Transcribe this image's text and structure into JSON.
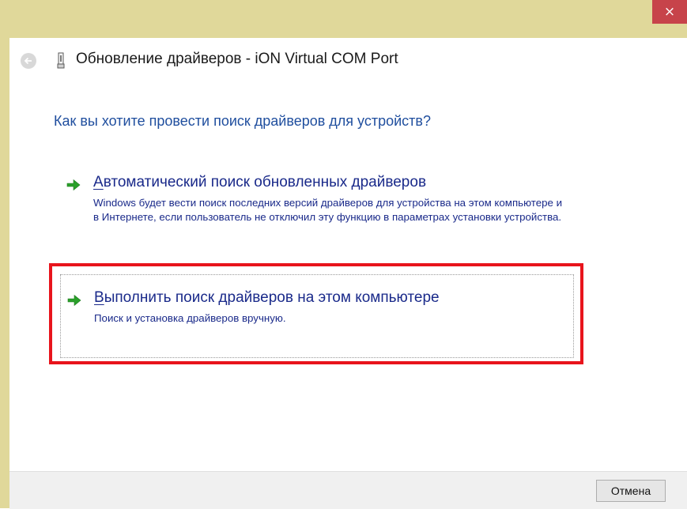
{
  "window": {
    "close_label": "×"
  },
  "header": {
    "title": "Обновление драйверов - iON Virtual COM Port",
    "back_icon": "back-arrow-icon",
    "device_icon": "usb-device-icon"
  },
  "main": {
    "question": "Как вы хотите провести поиск драйверов для устройств?",
    "options": [
      {
        "title_first": "А",
        "title_rest": "втоматический поиск обновленных драйверов",
        "description": "Windows будет вести поиск последних версий драйверов для устройства на этом компьютере и в Интернете, если пользователь не отключил эту функцию в параметрах установки устройства.",
        "icon": "green-arrow-icon"
      },
      {
        "title_first": "В",
        "title_rest": "ыполнить поиск драйверов на этом компьютере",
        "description": "Поиск и установка драйверов вручную.",
        "icon": "green-arrow-icon",
        "highlighted": true
      }
    ]
  },
  "footer": {
    "cancel_label": "Отмена"
  },
  "colors": {
    "frame": "#e0d89a",
    "close": "#c7434a",
    "question_text": "#1f4e9e",
    "link_text": "#1a2a8a",
    "arrow": "#2aa02a",
    "highlight_border": "#e8141c"
  }
}
